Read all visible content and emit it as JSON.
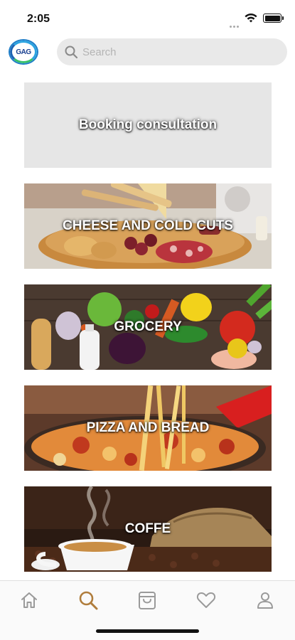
{
  "status_bar": {
    "time": "2:05",
    "icons": [
      "signal-dots-icon",
      "wifi-icon",
      "battery-icon"
    ]
  },
  "header": {
    "logo_text": "GAG",
    "search": {
      "placeholder": "Search",
      "value": ""
    }
  },
  "categories": [
    {
      "label": "Booking consultation",
      "image": "none"
    },
    {
      "label": "CHEESE AND COLD CUTS",
      "image": "cheese-board-photo"
    },
    {
      "label": "GROCERY",
      "image": "vegetables-photo"
    },
    {
      "label": "PIZZA AND BREAD",
      "image": "pizza-photo"
    },
    {
      "label": "COFFE",
      "image": "coffee-cup-photo"
    }
  ],
  "tab_bar": {
    "active_index": 1,
    "active_color": "#b07d3c",
    "inactive_color": "#9a9a9a",
    "tabs": [
      {
        "icon": "home-icon"
      },
      {
        "icon": "search-icon"
      },
      {
        "icon": "shopping-bag-icon"
      },
      {
        "icon": "heart-icon"
      },
      {
        "icon": "profile-icon"
      }
    ]
  }
}
